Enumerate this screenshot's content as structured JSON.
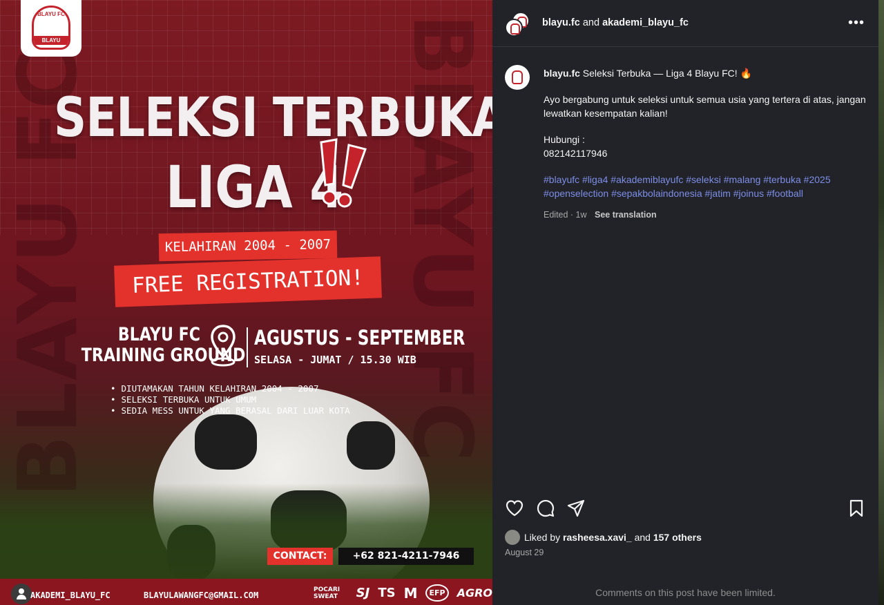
{
  "poster": {
    "logo_top": "BLAYU FC",
    "logo_ribbon": "BLAYU",
    "bg_text": "BLAYU FC",
    "title_line1": "SELEKSI TERBUKA",
    "title_line2": "LIGA 4",
    "birth_range": "KELAHIRAN 2004 - 2007",
    "free_registration": "FREE REGISTRATION!",
    "venue_line1": "BLAYU FC",
    "venue_line2": "TRAINING GROUND",
    "months": "AGUSTUS - SEPTEMBER",
    "schedule": "SELASA - JUMAT / 15.30 WIB",
    "bullets": [
      "DIUTAMAKAN TAHUN KELAHIRAN 2004 - 2007",
      "SELEKSI TERBUKA UNTUK UMUM",
      "SEDIA MESS UNTUK YANG BERASAL DARI LUAR KOTA"
    ],
    "contact_label": "CONTACT:",
    "contact_number": "+62 821-4211-7946",
    "footer_handle": "AKADEMI_BLAYU_FC",
    "footer_email": "BLAYULAWANGFC@GMAIL.COM",
    "sponsors": [
      "POCARI SWEAT",
      "SJ",
      "TS",
      "M",
      "EFP",
      "AGRO"
    ],
    "colors": {
      "red": "#e3312c",
      "maroon": "#7d1a22"
    }
  },
  "header": {
    "user1": "blayu.fc",
    "joiner": "and",
    "user2": "akademi_blayu_fc",
    "more_icon": "more-horizontal-icon"
  },
  "caption": {
    "username": "blayu.fc",
    "headline": "Seleksi Terbuka — Liga 4 Blayu FC! 🔥",
    "body1": "Ayo bergabung untuk seleksi untuk semua usia yang tertera di atas, jangan lewatkan kesempatan kalian!",
    "contact_label": "Hubungi :",
    "contact_number": "082142117946",
    "hashtags_line1": "#blayufc #liga4 #akademiblayufc #seleksi #malang #terbuka #2025",
    "hashtags_line2": "#openselection #sepakbolaindonesia #jatim #joinus #football",
    "edited": "Edited · 1w",
    "see_translation": "See translation"
  },
  "likes": {
    "prefix": "Liked by",
    "user": "rasheesa.xavi_",
    "middle": "and",
    "others": "157 others"
  },
  "date": "August 29",
  "comments_limited": "Comments on this post have been limited.",
  "icons": [
    "heart-icon",
    "comment-icon",
    "share-icon",
    "bookmark-icon"
  ],
  "colors": {
    "panel_bg": "#212328",
    "hashtag": "#7d8ee8",
    "muted": "#a8a8a8"
  }
}
